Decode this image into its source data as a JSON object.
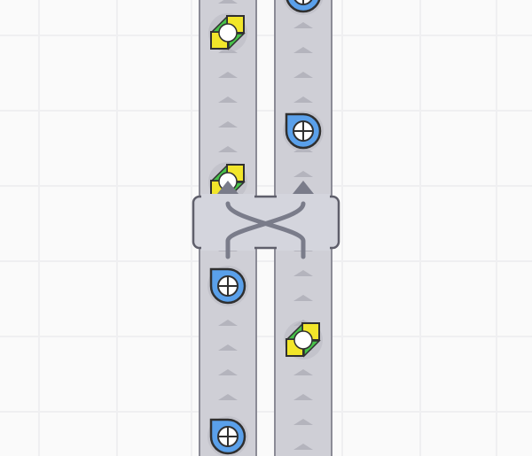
{
  "board": {
    "background": "#fafafa",
    "grid_color": "#efeff1",
    "belt_fill": "#cfcfd6",
    "belt_edge": "#8b8b96",
    "chevron_color": "#b4b4bd",
    "crossover_fill": "#d4d5dd",
    "crossover_edge": "#5f5f6b",
    "crossover_arrow": "#7a7c8a"
  },
  "belts": [
    {
      "id": "left",
      "direction": "up"
    },
    {
      "id": "right",
      "direction": "up"
    }
  ],
  "crossover": {
    "type": "belt-crossover",
    "icon": "crossing-arrows-icon"
  },
  "items": [
    {
      "kind": "cross-square-shape",
      "belt": "left",
      "color": "#f2e62a",
      "accent": "#47c24a"
    },
    {
      "kind": "circle-quarter-shape",
      "belt": "right",
      "color": "#5aa0ea"
    },
    {
      "kind": "cross-square-shape",
      "belt": "left",
      "color": "#f2e62a",
      "accent": "#47c24a"
    },
    {
      "kind": "circle-quarter-shape",
      "belt": "left",
      "color": "#5aa0ea"
    },
    {
      "kind": "cross-square-shape",
      "belt": "right",
      "color": "#f2e62a",
      "accent": "#47c24a"
    },
    {
      "kind": "circle-quarter-shape",
      "belt": "left",
      "color": "#5aa0ea"
    },
    {
      "kind": "circle-quarter-shape",
      "belt": "right",
      "color": "#5aa0ea"
    }
  ]
}
